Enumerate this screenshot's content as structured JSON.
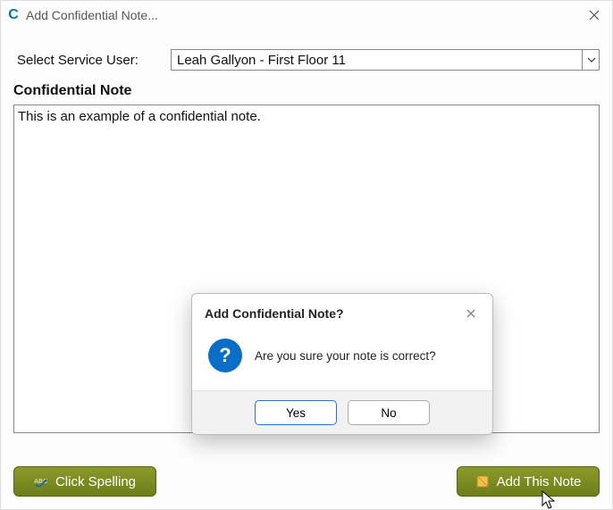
{
  "window": {
    "title": "Add Confidential Note...",
    "app_icon_letter": "C"
  },
  "form": {
    "select_label": "Select Service User:",
    "select_value": "Leah Gallyon - First Floor 11",
    "section_heading": "Confidential Note",
    "note_text": "This is an example of a confidential note."
  },
  "buttons": {
    "spelling": "Click Spelling",
    "add_note": "Add This Note"
  },
  "dialog": {
    "title": "Add Confidential Note?",
    "message": "Are you sure your note is correct?",
    "yes": "Yes",
    "no": "No",
    "question_mark": "?"
  }
}
